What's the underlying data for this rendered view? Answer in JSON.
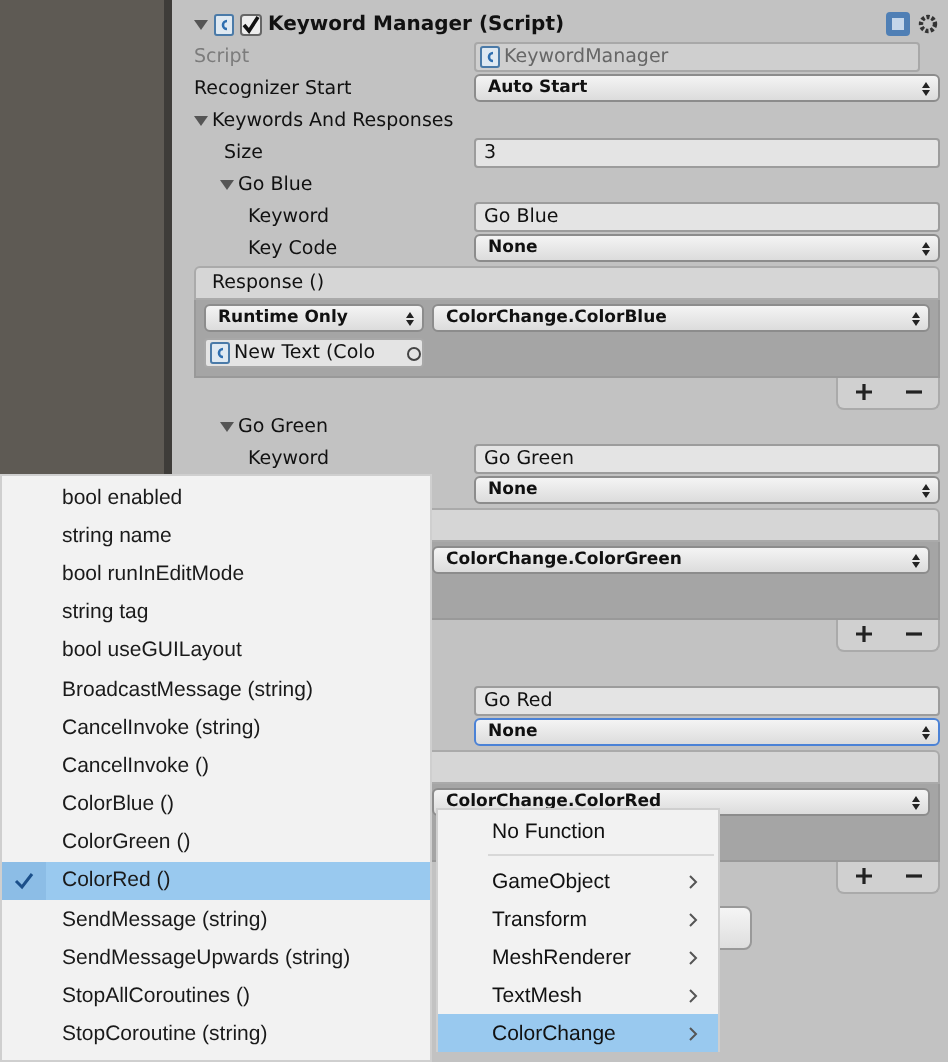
{
  "component": {
    "title": "Keyword Manager (Script)",
    "enabled": true,
    "expanded": true,
    "fields": [
      {
        "label": "Script",
        "value": "KeywordManager",
        "kind": "object",
        "disabled": true
      },
      {
        "label": "Recognizer Start",
        "value": "Auto Start",
        "kind": "dropdown",
        "disabled": false
      }
    ]
  },
  "keywords_and_responses": {
    "label": "Keywords And Responses",
    "expanded": true,
    "size_label": "Size",
    "size": "3",
    "entries": [
      {
        "title": "Go Blue",
        "expanded": true,
        "fields": [
          {
            "label": "Keyword",
            "value": "Go Blue",
            "kind": "text",
            "focused": false
          },
          {
            "label": "Key Code",
            "value": "None",
            "kind": "dropdown",
            "focused": false
          }
        ],
        "response": {
          "header": "Response ()",
          "mode": "Runtime Only",
          "function": "ColorChange.ColorBlue",
          "target": "New Text (Colo"
        }
      },
      {
        "title": "Go Green",
        "expanded": true,
        "fields": [
          {
            "label": "Keyword",
            "value": "Go Green",
            "kind": "text",
            "focused": false
          },
          {
            "value": "None",
            "kind": "dropdown",
            "focused": false
          }
        ],
        "response": {
          "function": "ColorChange.ColorGreen"
        }
      },
      {
        "fields": [
          {
            "value": "Go Red",
            "kind": "text",
            "focused": false
          },
          {
            "value": "None",
            "kind": "dropdown",
            "focused": true
          }
        ],
        "response": {
          "function": "ColorChange.ColorRed"
        }
      }
    ]
  },
  "function_menu": {
    "items": [
      {
        "kind": "item",
        "label": "No Function",
        "selected": false
      },
      {
        "kind": "separator"
      },
      {
        "kind": "submenu",
        "label": "GameObject",
        "selected": false
      },
      {
        "kind": "submenu",
        "label": "Transform",
        "selected": false
      },
      {
        "kind": "submenu",
        "label": "MeshRenderer",
        "selected": false
      },
      {
        "kind": "submenu",
        "label": "TextMesh",
        "selected": false
      },
      {
        "kind": "submenu",
        "label": "ColorChange",
        "selected": true
      }
    ]
  },
  "method_menu": {
    "items": [
      {
        "label": "bool enabled",
        "checked": false,
        "selected": false
      },
      {
        "label": "string name",
        "checked": false,
        "selected": false
      },
      {
        "label": "bool runInEditMode",
        "checked": false,
        "selected": false
      },
      {
        "label": "string tag",
        "checked": false,
        "selected": false
      },
      {
        "label": "bool useGUILayout",
        "checked": false,
        "selected": false
      },
      {
        "label": "BroadcastMessage (string)",
        "checked": false,
        "selected": false
      },
      {
        "label": "CancelInvoke (string)",
        "checked": false,
        "selected": false
      },
      {
        "label": "CancelInvoke ()",
        "checked": false,
        "selected": false
      },
      {
        "label": "ColorBlue ()",
        "checked": false,
        "selected": false
      },
      {
        "label": "ColorGreen ()",
        "checked": false,
        "selected": false
      },
      {
        "label": "ColorRed ()",
        "checked": true,
        "selected": true
      },
      {
        "label": "SendMessage (string)",
        "checked": false,
        "selected": false
      },
      {
        "label": "SendMessageUpwards (string)",
        "checked": false,
        "selected": false
      },
      {
        "label": "StopAllCoroutines ()",
        "checked": false,
        "selected": false
      },
      {
        "label": "StopCoroutine (string)",
        "checked": false,
        "selected": false
      }
    ]
  }
}
